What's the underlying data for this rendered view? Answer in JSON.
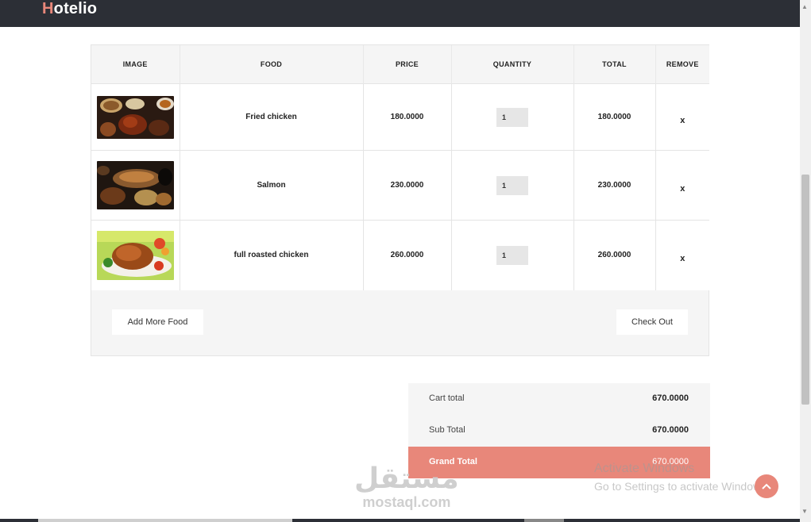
{
  "brand": {
    "first_letter": "H",
    "rest": "otelio",
    "accent": "#e8877a"
  },
  "cart": {
    "headers": [
      "IMAGE",
      "FOOD",
      "PRICE",
      "QUANTITY",
      "TOTAL",
      "REMOVE"
    ],
    "items": [
      {
        "food": "Fried chicken",
        "price": "180.0000",
        "quantity": "1",
        "total": "180.0000",
        "remove": "x",
        "image": "fried-chicken-photo"
      },
      {
        "food": "Salmon",
        "price": "230.0000",
        "quantity": "1",
        "total": "230.0000",
        "remove": "x",
        "image": "salmon-photo"
      },
      {
        "food": "full roasted chicken",
        "price": "260.0000",
        "quantity": "1",
        "total": "260.0000",
        "remove": "x",
        "image": "roasted-chicken-photo"
      }
    ],
    "add_more_label": "Add More Food",
    "checkout_label": "Check Out"
  },
  "totals": {
    "cart_total_label": "Cart total",
    "cart_total_value": "670.0000",
    "sub_total_label": "Sub Total",
    "sub_total_value": "670.0000",
    "grand_total_label": "Grand Total",
    "grand_total_value": "670.0000"
  },
  "watermark": {
    "line1": "Activate Windows",
    "line2": "Go to Settings to activate Windows."
  },
  "mostaql": {
    "arabic": "مستقل",
    "latin": "mostaql.com"
  }
}
